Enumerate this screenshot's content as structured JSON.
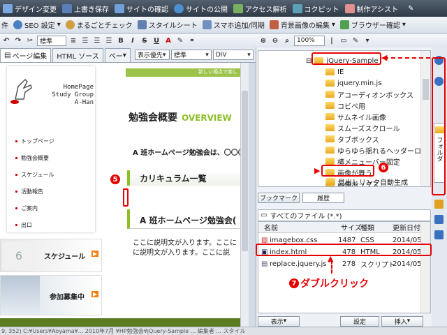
{
  "toolbar1": {
    "items": [
      {
        "label": "デザイン変更",
        "color": "#7aa8e0"
      },
      {
        "label": "上書き保存",
        "color": "#5a7fb8"
      },
      {
        "label": "サイトの確認",
        "color": "#6fa0d8"
      },
      {
        "label": "サイトの公開",
        "color": "#4c8fcf"
      },
      {
        "label": "アクセス解析",
        "color": "#78b060"
      },
      {
        "label": "コクピット",
        "color": "#5aa0b8"
      },
      {
        "label": "制作アシスト",
        "color": "#e09090"
      }
    ]
  },
  "toolbar2": {
    "items": [
      {
        "label": "件",
        "color": "#9aa"
      },
      {
        "label": "SEO 設定",
        "color": "#4a80c0"
      },
      {
        "label": "まるごとチェック",
        "color": "#d0a040"
      },
      {
        "label": "スタイルシート",
        "color": "#6080b0"
      },
      {
        "label": "スマホ追加/同期",
        "color": "#7090c0"
      },
      {
        "label": "背景画像の編集",
        "color": "#c06040"
      },
      {
        "label": "ブラウザー確認",
        "color": "#50a050"
      }
    ]
  },
  "toolbar3": {
    "style_select": "標準",
    "format_select": "標準",
    "div_select": "DIV",
    "zoom": "100%",
    "bold": "B",
    "italic": "I",
    "strike": "S"
  },
  "tabs": [
    {
      "label": "ページ編集",
      "active": true
    },
    {
      "label": "HTML ソース",
      "active": false
    },
    {
      "label": "ペー",
      "active": false
    }
  ],
  "view_select": "表示優先",
  "page": {
    "banner_text": "新しい視点で楽し",
    "logo_text": [
      "HomePage",
      "Study Group",
      "A-Han"
    ],
    "nav": [
      "トップページ",
      "勉強会概要",
      "スケジュール",
      "活動報告",
      "ご案内",
      "出口"
    ],
    "heading": "勉強会概要",
    "heading_en": "OVERVIEW",
    "intro": "A 班ホームページ勉強会は、〇〇〇",
    "section1": "カリキュラム一覧",
    "section2": "A 班ホームページ勉強会(",
    "body1": "ここに説明文が入ります。ここに",
    "body2": "に説明文が入ります。ここに説",
    "banner_schedule": "スケジュール",
    "banner_recruit": "参加募集中",
    "arrow": "▶"
  },
  "annotations": {
    "n5": "5",
    "n6": "6",
    "n7": "7",
    "double_click": "ダブルクリック"
  },
  "tree": {
    "root": "jQuery-Sample",
    "items": [
      "IE",
      "jquery.min.js",
      "アコーディオンボックス",
      "コビペ用",
      "サムネイル画像",
      "スムーズスクロール",
      "タブボックス",
      "ゆらゆら揺れるヘッダーロゴ",
      "横メニューバー固定",
      "画像が舞う",
      "画像ボックス",
      "見出しリンク自動生成"
    ],
    "selected": "画像ボックス"
  },
  "panel_tabs": [
    "ブックマーク",
    "履歴"
  ],
  "filter": "すべてのファイル (*.*)",
  "file_list": {
    "headers": [
      "名前",
      "サイズ",
      "種類",
      "更新日付"
    ],
    "rows": [
      {
        "name": "imagebox.css",
        "size": "1487",
        "type": "CSS",
        "date": "2014/05/"
      },
      {
        "name": "index.html",
        "size": "478",
        "type": "HTML",
        "date": "2014/05/"
      },
      {
        "name": "replace.jquery.js",
        "size": "278",
        "type": "スクリプト",
        "date": "2014/05/"
      }
    ]
  },
  "buttons": {
    "view": "表示",
    "settings": "設定",
    "insert": "挿入"
  },
  "side_tab": "フォルダ",
  "status": "9, 352)   C:¥Users¥Aoyama¥... 2010年7月 ¥HP勉強会¥jQuery-Sample ... 編集者 ... スタイル"
}
